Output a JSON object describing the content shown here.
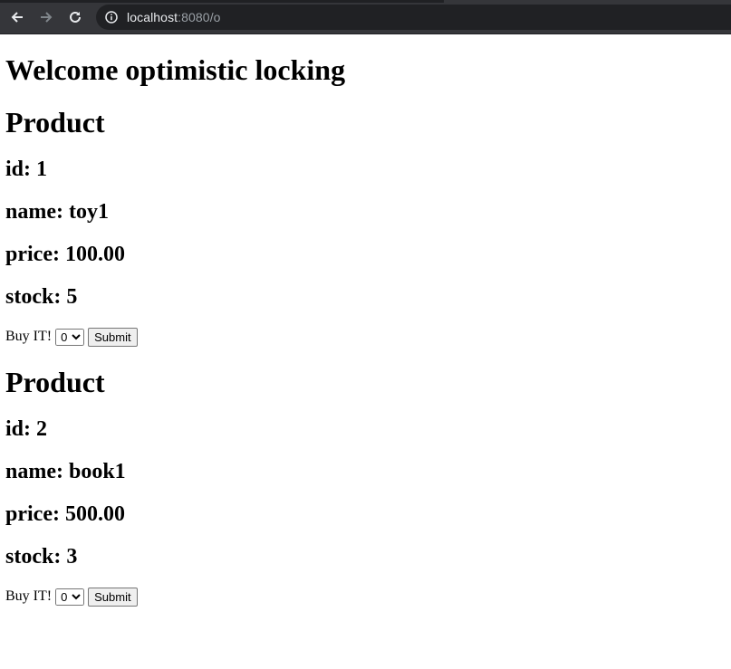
{
  "browser": {
    "url_host": "localhost",
    "url_rest": ":8080/o"
  },
  "page": {
    "title": "Welcome optimistic locking",
    "products": [
      {
        "heading": "Product",
        "id_line": "id: 1",
        "name_line": "name: toy1",
        "price_line": "price: 100.00",
        "stock_line": "stock: 5",
        "buy_label": "Buy IT!",
        "quantity_selected": "0",
        "submit_label": "Submit"
      },
      {
        "heading": "Product",
        "id_line": "id: 2",
        "name_line": "name: book1",
        "price_line": "price: 500.00",
        "stock_line": "stock: 3",
        "buy_label": "Buy IT!",
        "quantity_selected": "0",
        "submit_label": "Submit"
      }
    ]
  }
}
